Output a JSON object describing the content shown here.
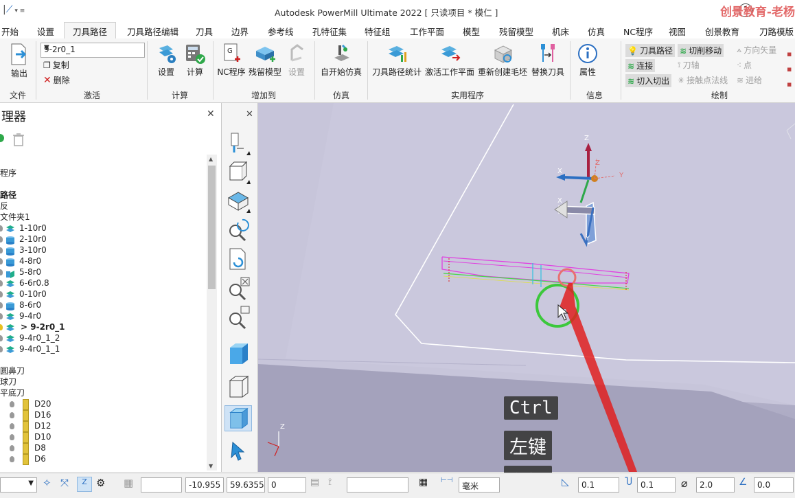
{
  "app": {
    "title": "Autodesk PowerMill Ultimate 2022   [ 只读项目 * 模仁 ]",
    "watermark": "创景教育-老杨"
  },
  "menu": {
    "tabs": [
      "开始",
      "设置",
      "刀具路径",
      "刀具路径编辑",
      "刀具",
      "边界",
      "参考线",
      "孔特征集",
      "特征组",
      "工作平面",
      "模型",
      "残留模型",
      "机床",
      "仿真",
      "NC程序",
      "视图",
      "创景教育",
      "刀路模版"
    ],
    "active_index": 2
  },
  "ribbon": {
    "file": {
      "output_label": "输出",
      "group_label": "文件"
    },
    "activate": {
      "selected_toolpath": "9-2r0_1",
      "copy_label": "复制",
      "delete_label": "删除",
      "group_label": "激活"
    },
    "calculate": {
      "settings_label": "设置",
      "calculate_label": "计算",
      "group_label": "计算"
    },
    "add_to": {
      "nc_label": "NC程序",
      "stock_label": "残留模型",
      "settings_label": "设置",
      "group_label": "增加到"
    },
    "simulation": {
      "start_label": "自开始仿真",
      "group_label": "仿真"
    },
    "utilities": {
      "stats_label": "刀具路径统计",
      "activate_wp_label": "激活工作平面",
      "recreate_block_label": "重新创建毛坯",
      "replace_tool_label": "替换刀具",
      "group_label": "实用程序"
    },
    "info": {
      "properties_label": "属性",
      "group_label": "信息"
    },
    "draw": {
      "toolpath_label": "刀具路径",
      "cut_moves_label": "切削移动",
      "links_label": "连接",
      "tool_axis_label": "刀轴",
      "lead_label": "切入切出",
      "contact_normal_label": "接触点法线",
      "direction_vector_label": "方向矢量",
      "points_label": "点",
      "feed_label": "进给",
      "group_label": "绘制"
    }
  },
  "explorer": {
    "title": "理器",
    "rows": [
      {
        "text": "",
        "kind": "plain"
      },
      {
        "text": "程序",
        "kind": "plain"
      },
      {
        "text": "",
        "kind": "plain"
      },
      {
        "text": "路径",
        "kind": "bold"
      },
      {
        "text": "反",
        "kind": "plain"
      },
      {
        "text": "文件夹1",
        "kind": "plain"
      },
      {
        "text": "1-10r0",
        "kind": "tp",
        "ico": "layers"
      },
      {
        "text": "2-10r0",
        "kind": "tp",
        "ico": "cyl"
      },
      {
        "text": "3-10r0",
        "kind": "tp",
        "ico": "cyl"
      },
      {
        "text": "4-8r0",
        "kind": "tp",
        "ico": "cyl"
      },
      {
        "text": "5-8r0",
        "kind": "tp",
        "ico": "mixed"
      },
      {
        "text": "6-6r0.8",
        "kind": "tp",
        "ico": "layers"
      },
      {
        "text": "0-10r0",
        "kind": "tp",
        "ico": "layers"
      },
      {
        "text": "8-6r0",
        "kind": "tp",
        "ico": "cyl"
      },
      {
        "text": "9-4r0",
        "kind": "tp",
        "ico": "layers"
      },
      {
        "text": "> 9-2r0_1",
        "kind": "tp-active",
        "ico": "layers"
      },
      {
        "text": "9-4r0_1_2",
        "kind": "tp",
        "ico": "layers"
      },
      {
        "text": "9-4r0_1_1",
        "kind": "tp",
        "ico": "layers"
      },
      {
        "text": "",
        "kind": "plain"
      },
      {
        "text": "圆鼻刀",
        "kind": "plain"
      },
      {
        "text": "球刀",
        "kind": "plain"
      },
      {
        "text": "平底刀",
        "kind": "plain"
      },
      {
        "text": "D20",
        "kind": "tool"
      },
      {
        "text": "D16",
        "kind": "tool"
      },
      {
        "text": "D12",
        "kind": "tool"
      },
      {
        "text": "D10",
        "kind": "tool"
      },
      {
        "text": "D8",
        "kind": "tool"
      },
      {
        "text": "D6",
        "kind": "tool"
      }
    ]
  },
  "viewport": {
    "axis_labels": {
      "z": "Z",
      "y": "Y",
      "x": "X"
    },
    "hints": [
      "Ctrl",
      "左键",
      "左键"
    ]
  },
  "statusbar": {
    "x": "-10.955",
    "y": "59.6355",
    "z": "0",
    "units": "毫米",
    "tolerance": "0.1",
    "thickness": "0.1",
    "diameter": "2.0",
    "angle": "0.0"
  },
  "colors": {
    "accent": "#2b8fd6",
    "toolpath": "#e040e0",
    "cursor": "#e02020"
  }
}
